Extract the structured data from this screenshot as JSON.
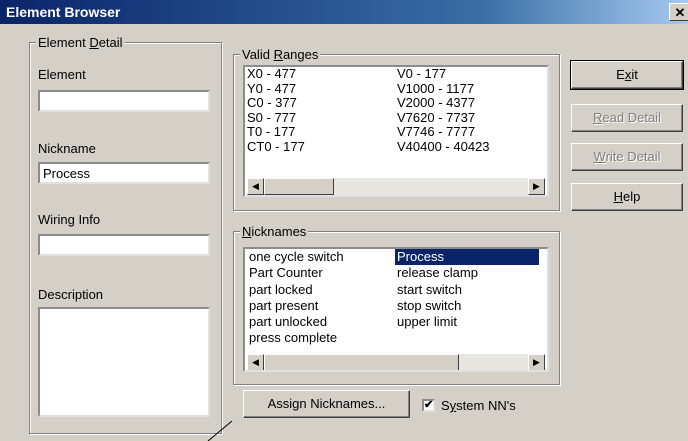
{
  "window": {
    "title": "Element Browser",
    "close_glyph": "✕"
  },
  "element_detail": {
    "group_label_pre": "Element ",
    "group_label_ul": "D",
    "group_label_post": "etail",
    "element_label": "Element",
    "element_value": "",
    "nickname_label": "Nickname",
    "nickname_value": "Process",
    "wiring_label": "Wiring Info",
    "wiring_value": "",
    "description_label": "Description",
    "description_value": ""
  },
  "valid_ranges": {
    "label_pre": "Valid ",
    "label_ul": "R",
    "label_post": "anges",
    "col1": [
      "X0 - 477",
      "Y0 - 477",
      "C0 - 377",
      "S0 - 777",
      "T0 - 177",
      "CT0 - 177"
    ],
    "col2": [
      "V0 - 177",
      "V1000 - 1177",
      "V2000 - 4377",
      "V7620 - 7737",
      "V7746 - 7777",
      "V40400 - 40423"
    ]
  },
  "nicknames": {
    "label_ul": "N",
    "label_post": "icknames",
    "col1": [
      "one cycle switch",
      "Part Counter",
      "part locked",
      "part present",
      "part unlocked",
      "press complete"
    ],
    "col2": [
      "Process",
      "release clamp",
      "start switch",
      "stop switch",
      "upper limit"
    ],
    "selected": "Process"
  },
  "buttons": {
    "exit_pre": "E",
    "exit_ul": "x",
    "exit_post": "it",
    "read_ul": "R",
    "read_post": "ead Detail",
    "write_ul": "W",
    "write_post": "rite Detail",
    "help_ul": "H",
    "help_post": "elp",
    "assign": "Assign Nicknames..."
  },
  "system_nn": {
    "label_pre": "S",
    "label_ul": "y",
    "label_post": "stem NN's",
    "checked": true,
    "check_glyph": "✔"
  },
  "icons": {
    "left": "◀",
    "right": "▶"
  }
}
